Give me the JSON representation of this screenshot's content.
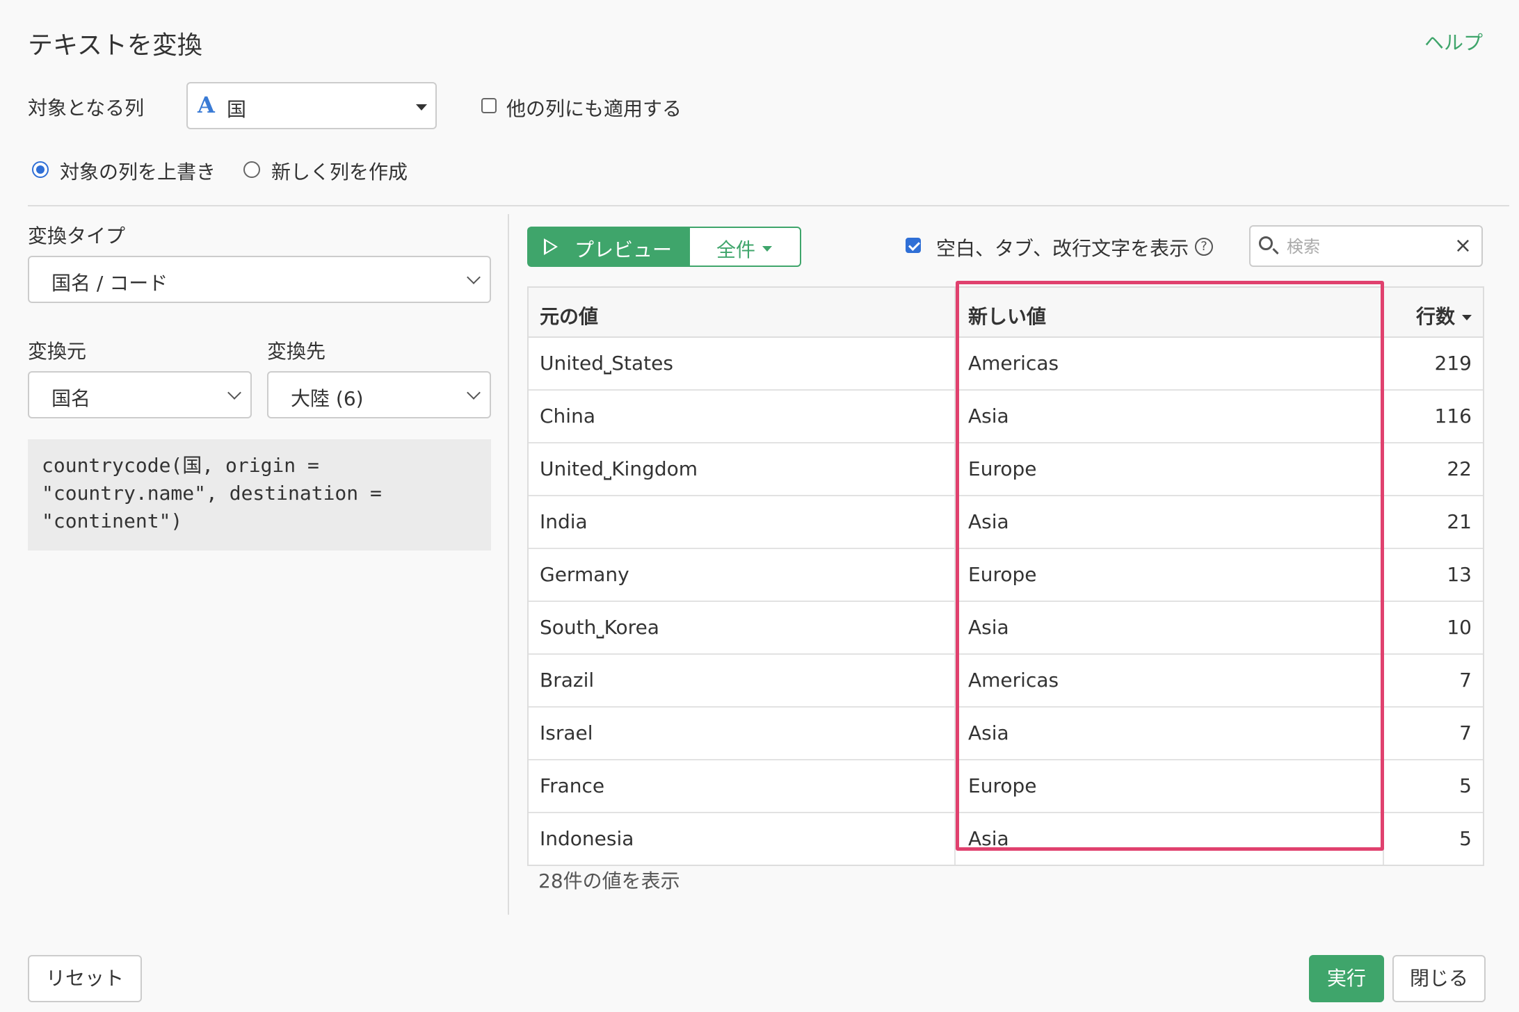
{
  "dialog": {
    "title": "テキストを変換",
    "help_label": "ヘルプ"
  },
  "target_column": {
    "label": "対象となる列",
    "type_icon": "A",
    "value": "国",
    "apply_other_label": "他の列にも適用する",
    "apply_other_checked": false
  },
  "output_mode": {
    "overwrite_label": "対象の列を上書き",
    "new_column_label": "新しく列を作成",
    "selected": "overwrite"
  },
  "conversion": {
    "type_label": "変換タイプ",
    "type_value": "国名 / コード",
    "source_label": "変換元",
    "source_value": "国名",
    "dest_label": "変換先",
    "dest_value": "大陸 (6)",
    "code": "countrycode(国, origin = \n\"country.name\", destination = \n\"continent\")"
  },
  "preview": {
    "preview_button": "プレビュー",
    "all_button": "全件",
    "show_whitespace_label": "空白、タブ、改行文字を表示",
    "show_whitespace_checked": true,
    "help_icon_text": "?",
    "search_placeholder": "検索",
    "clear_icon_text": "×",
    "columns": {
      "original": "元の値",
      "new": "新しい値",
      "count": "行数"
    },
    "rows": [
      {
        "original": "United⎵States",
        "new": "Americas",
        "count": "219"
      },
      {
        "original": "China",
        "new": "Asia",
        "count": "116"
      },
      {
        "original": "United⎵Kingdom",
        "new": "Europe",
        "count": "22"
      },
      {
        "original": "India",
        "new": "Asia",
        "count": "21"
      },
      {
        "original": "Germany",
        "new": "Europe",
        "count": "13"
      },
      {
        "original": "South⎵Korea",
        "new": "Asia",
        "count": "10"
      },
      {
        "original": "Brazil",
        "new": "Americas",
        "count": "7"
      },
      {
        "original": "Israel",
        "new": "Asia",
        "count": "7"
      },
      {
        "original": "France",
        "new": "Europe",
        "count": "5"
      },
      {
        "original": "Indonesia",
        "new": "Asia",
        "count": "5"
      }
    ],
    "footer": "28件の値を表示"
  },
  "buttons": {
    "reset": "リセット",
    "run": "実行",
    "close": "閉じる"
  },
  "colors": {
    "accent_green": "#3fa56b",
    "highlight_pink": "#e0416e",
    "selection_blue": "#2f6fd6"
  }
}
